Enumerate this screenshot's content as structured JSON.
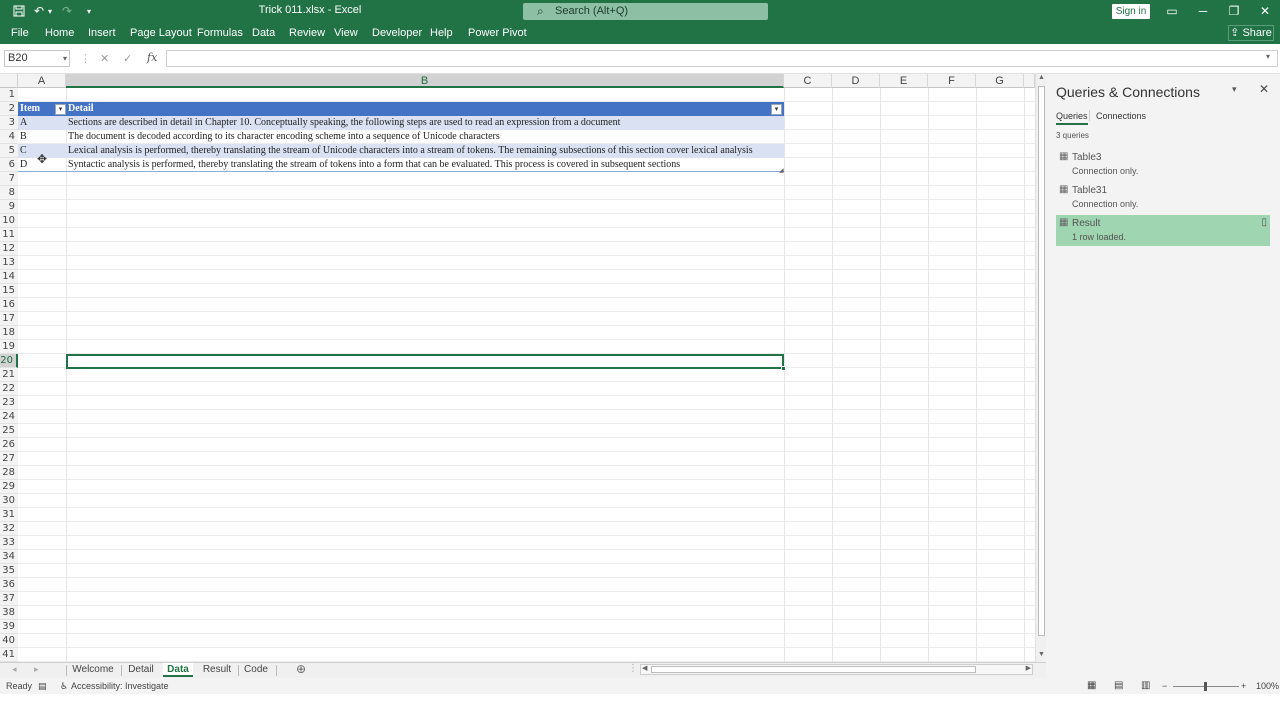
{
  "titlebar": {
    "title": "Trick 011.xlsx  -  Excel",
    "search_placeholder": "Search (Alt+Q)",
    "sign_in": "Sign in",
    "accent": "#217346"
  },
  "menu": {
    "tabs": [
      "File",
      "Home",
      "Insert",
      "Page Layout",
      "Formulas",
      "Data",
      "Review",
      "View",
      "Developer",
      "Help",
      "Power Pivot"
    ],
    "share": "Share"
  },
  "formula_bar": {
    "name_box": "B20",
    "cancel_icon": "✕",
    "enter_icon": "✓",
    "fx": "fx",
    "value": ""
  },
  "sheet": {
    "columns": [
      "A",
      "B",
      "C",
      "D",
      "E",
      "F",
      "G"
    ],
    "selected_column": "B",
    "rows": [
      "1",
      "2",
      "3",
      "4",
      "5",
      "6",
      "7",
      "8",
      "9",
      "10",
      "11",
      "12",
      "13",
      "14",
      "15",
      "16",
      "17",
      "18",
      "19",
      "20",
      "21",
      "22",
      "23",
      "24",
      "25",
      "26",
      "27",
      "28",
      "29",
      "30",
      "31",
      "32",
      "33",
      "34",
      "35",
      "36",
      "37",
      "38",
      "39",
      "40",
      "41"
    ],
    "selected_row": "20",
    "table": {
      "headers": [
        "Item",
        "Detail"
      ],
      "rows": [
        [
          "A",
          "Sections are described in detail in Chapter 10. Conceptually speaking, the following steps are used to read an expression from a document"
        ],
        [
          "B",
          "The document is decoded according to its character encoding scheme into a sequence of Unicode characters"
        ],
        [
          "C",
          "Lexical analysis is performed, thereby translating the stream of Unicode characters into a stream of tokens. The remaining subsections of this section cover lexical analysis"
        ],
        [
          "D",
          "Syntactic analysis is performed, thereby translating the stream of tokens into a form that can be evaluated. This process is covered in subsequent sections"
        ]
      ],
      "header_color": "#4472c4",
      "band_color": "#d9e1f2"
    }
  },
  "sheet_tabs": {
    "tabs": [
      "Welcome",
      "Detail",
      "Data",
      "Result",
      "Code"
    ],
    "active": "Data"
  },
  "status": {
    "ready": "Ready",
    "accessibility": "Accessibility: Investigate",
    "zoom": "100%"
  },
  "queries_pane": {
    "title": "Queries & Connections",
    "tabs": [
      "Queries",
      "Connections"
    ],
    "count": "3 queries",
    "items": [
      {
        "name": "Table3",
        "status": "Connection only."
      },
      {
        "name": "Table31",
        "status": "Connection only."
      },
      {
        "name": "Result",
        "status": "1 row loaded."
      }
    ],
    "selected_color": "#9fd5b1"
  }
}
